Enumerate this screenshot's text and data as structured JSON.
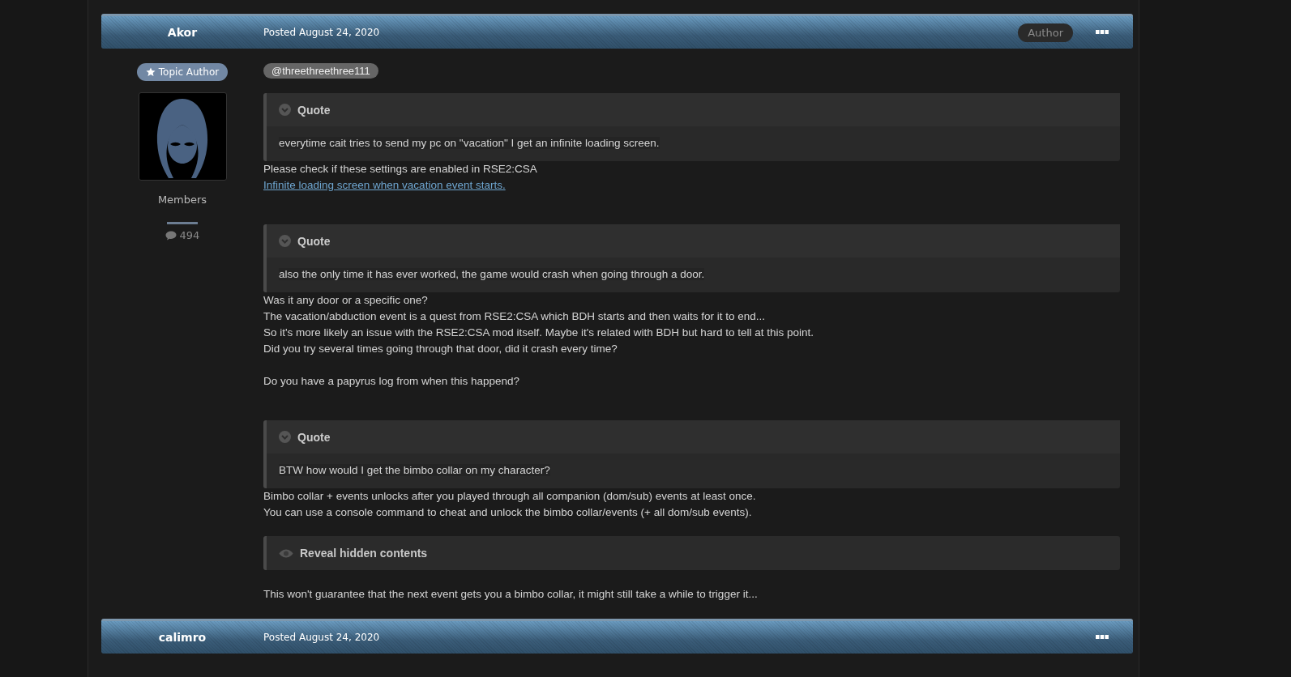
{
  "posts": [
    {
      "author": "Akor",
      "date": "Posted August 24, 2020",
      "author_tag": "Author",
      "topic_author_badge": "Topic Author",
      "group": "Members",
      "post_count": "494",
      "content": [
        {
          "kind": "mention",
          "text": "@threethreethree111"
        },
        {
          "kind": "quote",
          "title": "Quote",
          "text": "everytime cait tries to send my pc on \"vacation\" I get an infinite loading screen."
        },
        {
          "kind": "text",
          "lines": [
            "Please check if these settings are enabled in RSE2:CSA"
          ],
          "link": "Infinite loading screen when vacation event starts."
        },
        {
          "kind": "quote",
          "title": "Quote",
          "text": "also the only time it has ever worked, the game would crash when going through a door."
        },
        {
          "kind": "text",
          "lines": [
            "Was it any door or a specific one?",
            "The vacation/abduction event is a quest from RSE2:CSA which BDH starts and then waits for it to end...",
            "So it's more likely an issue with the RSE2:CSA mod itself. Maybe it's related with BDH but hard to tell at this point.",
            "Did you try several times going through that door, did it crash every time?"
          ]
        },
        {
          "kind": "text",
          "lines": [
            "Do you have a papyrus log from when this happend?"
          ]
        },
        {
          "kind": "quote",
          "title": "Quote",
          "text": "BTW how would I get the bimbo collar on my character?"
        },
        {
          "kind": "text",
          "lines": [
            "Bimbo collar + events unlocks after you played through all companion (dom/sub) events at least once.",
            "You can use a console command to cheat and unlock the bimbo collar/events (+ all dom/sub events)."
          ]
        },
        {
          "kind": "hidden",
          "title": "Reveal hidden contents"
        },
        {
          "kind": "text",
          "lines": [
            "This won't guarantee that the next event gets you a bimbo collar, it might still take a while to trigger it..."
          ]
        }
      ]
    },
    {
      "author": "calimro",
      "date": "Posted August 24, 2020"
    }
  ]
}
